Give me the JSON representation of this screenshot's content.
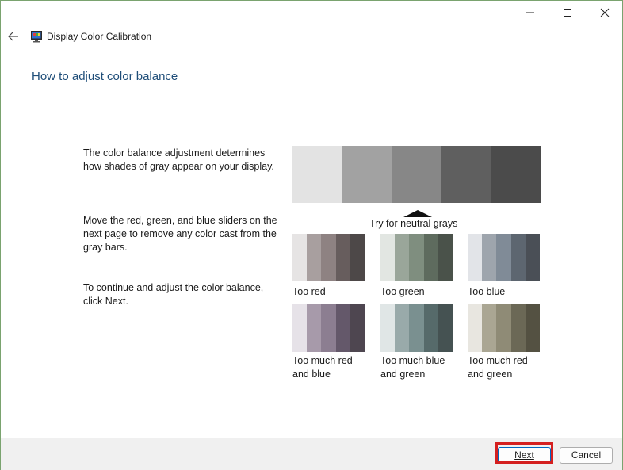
{
  "window": {
    "title": "Display Color Calibration",
    "controls": {
      "minimize": "minimize-icon",
      "maximize": "maximize-icon",
      "close": "close-icon"
    }
  },
  "page": {
    "heading": "How to adjust color balance",
    "paragraphs": [
      "The color balance adjustment determines how shades of gray appear on your display.",
      "Move the red, green, and blue sliders on the next page to remove any color cast from the gray bars.",
      "To continue and adjust the color balance, click Next."
    ],
    "neutral_label": "Try for neutral grays",
    "neutral_bar_colors": [
      "#e3e3e3",
      "#a2a2a2",
      "#878787",
      "#5f5f5f",
      "#4b4b4b"
    ],
    "samples": [
      {
        "label": "Too red",
        "colors": [
          "#e6e4e4",
          "#a89f9f",
          "#8e8282",
          "#675d5d",
          "#4d4848"
        ]
      },
      {
        "label": "Too green",
        "colors": [
          "#e2e6e2",
          "#9aa69a",
          "#7f8e7f",
          "#5e6b5e",
          "#4a524a"
        ]
      },
      {
        "label": "Too blue",
        "colors": [
          "#e2e4e8",
          "#9ea5ad",
          "#808b97",
          "#5d6670",
          "#4a4f56"
        ]
      },
      {
        "label": "Too much red and blue",
        "colors": [
          "#e6e2e8",
          "#a79aaa",
          "#8c7e91",
          "#64586a",
          "#4e4650"
        ]
      },
      {
        "label": "Too much blue and green",
        "colors": [
          "#e0e6e6",
          "#99aaaa",
          "#7a9090",
          "#566a6a",
          "#455252"
        ]
      },
      {
        "label": "Too much red and green",
        "colors": [
          "#e8e6e0",
          "#aaa693",
          "#8f8b76",
          "#6b6856",
          "#545142"
        ]
      }
    ]
  },
  "footer": {
    "next_label": "Next",
    "cancel_label": "Cancel"
  },
  "colors": {
    "heading": "#1f4e79",
    "highlight": "#d42020",
    "window_border": "#7aa36f"
  }
}
